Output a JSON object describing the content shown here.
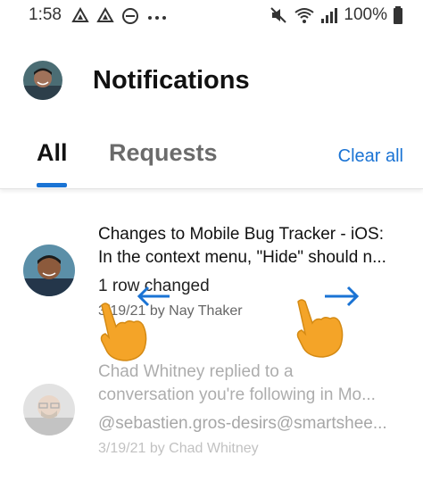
{
  "status_bar": {
    "time": "1:58",
    "battery": "100%",
    "left_icons": [
      "drive-icon",
      "drive-icon",
      "do-not-disturb-icon",
      "more-dots-icon"
    ],
    "right_icons": [
      "mute-icon",
      "wifi-icon",
      "signal-icon",
      "battery-icon"
    ]
  },
  "header": {
    "title": "Notifications"
  },
  "tabs": {
    "all": "All",
    "requests": "Requests",
    "clear_all": "Clear all",
    "active": "All"
  },
  "notifications": [
    {
      "title": "Changes to Mobile Bug Tracker - iOS:",
      "title_line2": "In the context menu, \"Hide\" should n...",
      "body": "1 row changed",
      "meta": "3/19/21 by Nay Thaker"
    },
    {
      "title": "Chad Whitney replied to a",
      "title_line2": "conversation you're following in Mo...",
      "body": "@sebastien.gros-desirs@smartshee...",
      "meta": "3/19/21 by Chad Whitney"
    }
  ],
  "colors": {
    "accent": "#1a73d4",
    "gesture_hand": "#f4a428"
  }
}
